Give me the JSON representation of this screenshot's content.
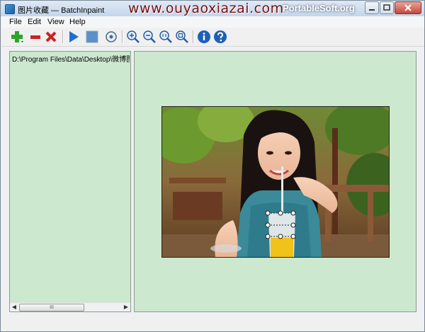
{
  "window": {
    "title": "图片收藏 — BatchInpaint",
    "watermark": "www.ouyaoxiazai.com",
    "watermark_overlay": "PortableSoft.org"
  },
  "menu": {
    "items": [
      {
        "label": "File"
      },
      {
        "label": "Edit"
      },
      {
        "label": "View"
      },
      {
        "label": "Help"
      }
    ]
  },
  "toolbar": {
    "buttons": [
      {
        "icon": "add-icon"
      },
      {
        "icon": "remove-icon"
      },
      {
        "icon": "delete-icon"
      },
      {
        "icon": "play-icon"
      },
      {
        "icon": "stop-icon"
      },
      {
        "icon": "settings-icon"
      },
      {
        "icon": "zoom-in-icon"
      },
      {
        "icon": "zoom-out-icon"
      },
      {
        "icon": "zoom-actual-icon"
      },
      {
        "icon": "zoom-fit-icon"
      },
      {
        "icon": "info-icon"
      },
      {
        "icon": "help-icon"
      }
    ]
  },
  "file_list": {
    "items": [
      {
        "path": "D:\\Program Files\\Data\\Desktop\\微博图片"
      }
    ]
  },
  "scrollbar": {
    "thumb_grip": "III"
  },
  "colors": {
    "panel_bg": "#cce8cf",
    "accent_green": "#2aa52a",
    "accent_red": "#d02020",
    "accent_blue": "#1e6fd0"
  }
}
